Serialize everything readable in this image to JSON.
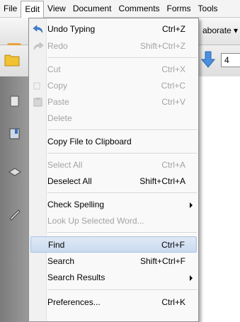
{
  "menubar": {
    "items": [
      {
        "label": "File"
      },
      {
        "label": "Edit"
      },
      {
        "label": "View"
      },
      {
        "label": "Document"
      },
      {
        "label": "Comments"
      },
      {
        "label": "Forms"
      },
      {
        "label": "Tools"
      }
    ]
  },
  "toolbar": {
    "collaborate_label": "aborate ▾",
    "page_number": "4"
  },
  "edit_menu": {
    "items": [
      {
        "label": "Undo Typing",
        "shortcut": "Ctrl+Z",
        "enabled": true,
        "icon": "undo-icon"
      },
      {
        "label": "Redo",
        "shortcut": "Shift+Ctrl+Z",
        "enabled": false,
        "icon": "redo-icon"
      },
      {
        "label": "Cut",
        "shortcut": "Ctrl+X",
        "enabled": false,
        "icon": ""
      },
      {
        "label": "Copy",
        "shortcut": "Ctrl+C",
        "enabled": false,
        "icon": "copy-icon"
      },
      {
        "label": "Paste",
        "shortcut": "Ctrl+V",
        "enabled": false,
        "icon": "paste-icon"
      },
      {
        "label": "Delete",
        "shortcut": "",
        "enabled": false,
        "icon": ""
      },
      {
        "label": "Copy File to Clipboard",
        "shortcut": "",
        "enabled": true,
        "icon": ""
      },
      {
        "label": "Select All",
        "shortcut": "Ctrl+A",
        "enabled": false,
        "icon": ""
      },
      {
        "label": "Deselect All",
        "shortcut": "Shift+Ctrl+A",
        "enabled": true,
        "icon": ""
      },
      {
        "label": "Check Spelling",
        "shortcut": "",
        "enabled": true,
        "icon": "",
        "submenu": true
      },
      {
        "label": "Look Up Selected Word...",
        "shortcut": "",
        "enabled": false,
        "icon": ""
      },
      {
        "label": "Find",
        "shortcut": "Ctrl+F",
        "enabled": true,
        "icon": "",
        "highlighted": true
      },
      {
        "label": "Search",
        "shortcut": "Shift+Ctrl+F",
        "enabled": true,
        "icon": ""
      },
      {
        "label": "Search Results",
        "shortcut": "",
        "enabled": true,
        "icon": "",
        "submenu": true
      },
      {
        "label": "Preferences...",
        "shortcut": "Ctrl+K",
        "enabled": true,
        "icon": ""
      }
    ]
  },
  "colors": {
    "highlight": "#c9dbef",
    "disabled_text": "#a3a3a3",
    "menu_bg": "#f9f9f9"
  }
}
